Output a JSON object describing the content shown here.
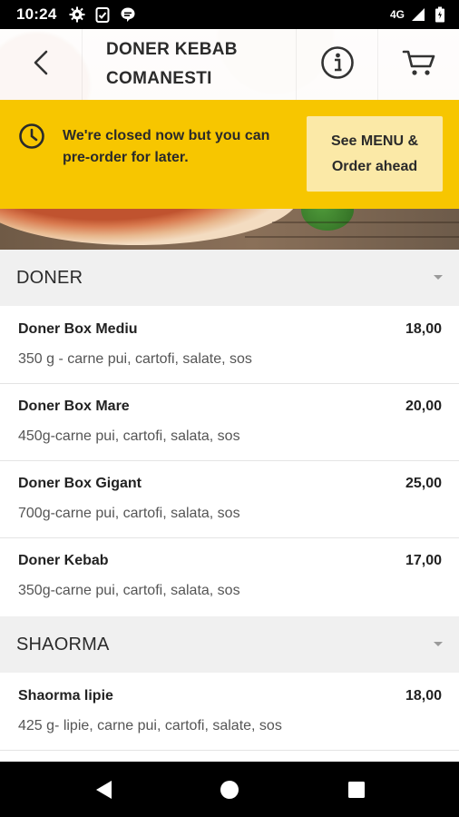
{
  "status_bar": {
    "time": "10:24",
    "network": "4G",
    "icons_left": [
      "settings-icon",
      "clipboard-icon",
      "chat-icon"
    ],
    "icons_right": [
      "signal-icon",
      "battery-icon"
    ]
  },
  "header": {
    "title_line1": "DONER KEBAB",
    "title_line2": "COMANESTI",
    "icons": [
      "back-arrow-icon",
      "info-icon",
      "cart-icon"
    ]
  },
  "banner": {
    "message": "We're closed now but you can pre-order for later.",
    "button_line1": "See MENU &",
    "button_line2": "Order ahead",
    "background": "#f7c600",
    "button_background": "#fbe9a7"
  },
  "sections": [
    {
      "title": "DONER",
      "items": [
        {
          "name": "Doner Box Mediu",
          "description": "350 g - carne pui, cartofi, salate, sos",
          "price": "18,00"
        },
        {
          "name": "Doner Box Mare",
          "description": "450g-carne pui, cartofi, salata, sos",
          "price": "20,00"
        },
        {
          "name": "Doner Box Gigant",
          "description": "700g-carne pui, cartofi, salata, sos",
          "price": "25,00"
        },
        {
          "name": "Doner Kebab",
          "description": "350g-carne pui, cartofi, salata, sos",
          "price": "17,00"
        }
      ]
    },
    {
      "title": "SHAORMA",
      "items": [
        {
          "name": "Shaorma lipie",
          "description": "425 g- lipie, carne pui, cartofi, salate, sos",
          "price": "18,00"
        }
      ]
    }
  ],
  "nav_bar": {
    "icons": [
      "back-triangle-icon",
      "home-circle-icon",
      "recents-square-icon"
    ]
  }
}
